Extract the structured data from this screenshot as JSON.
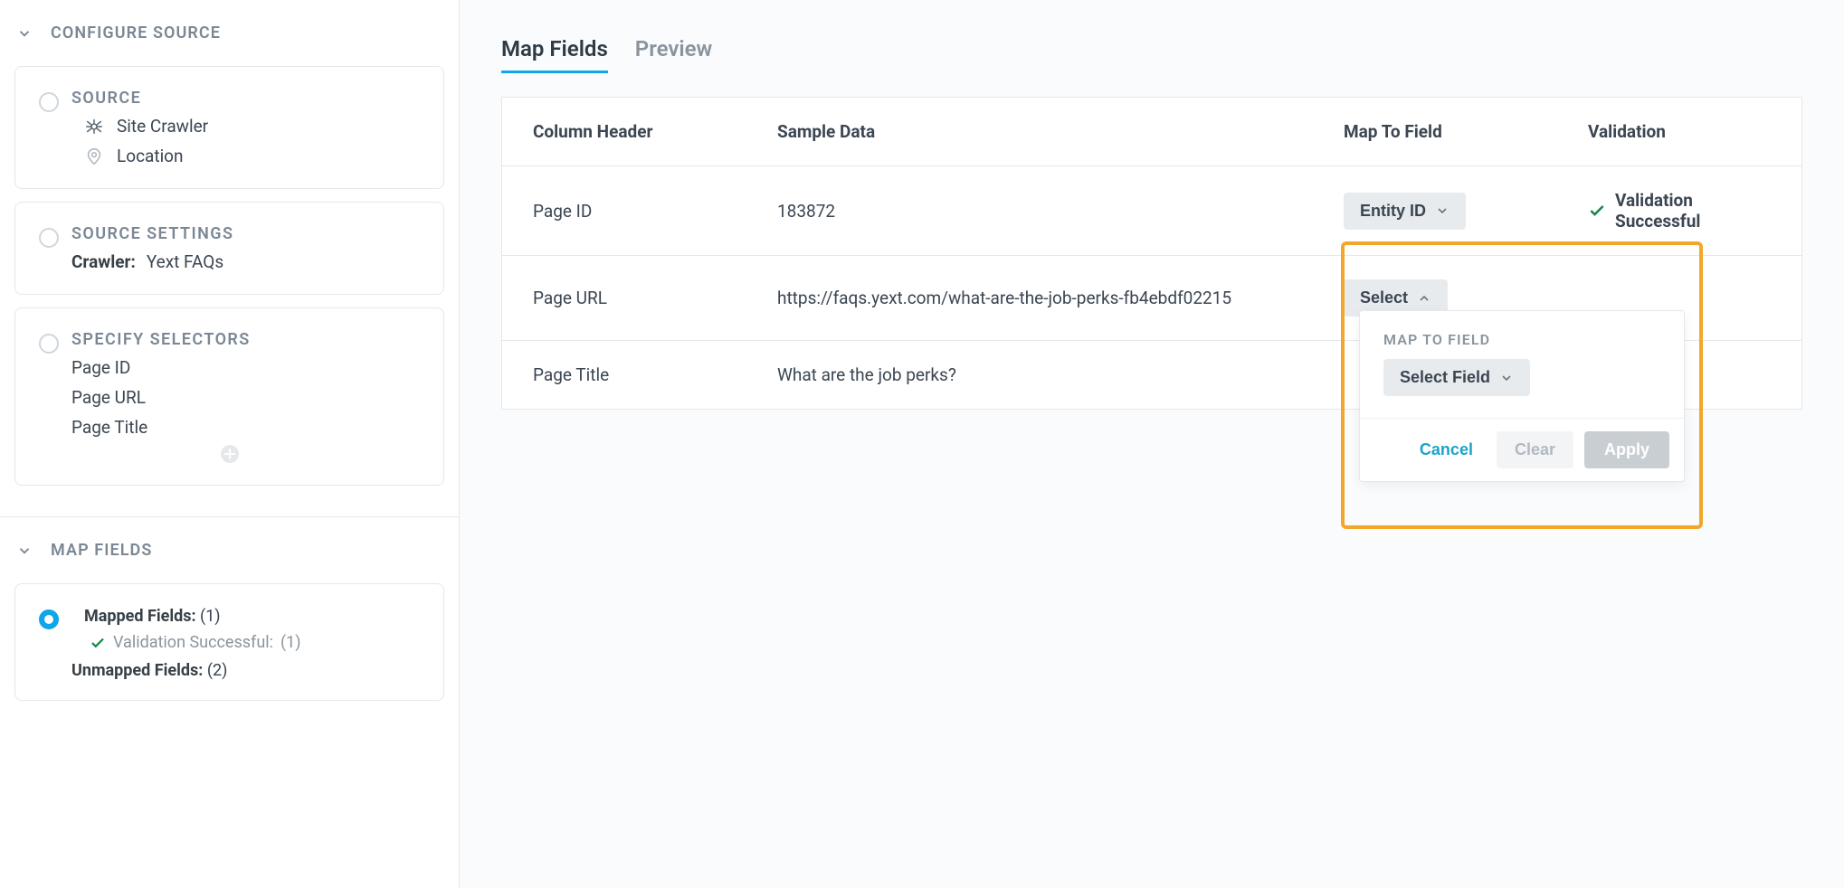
{
  "sidebar": {
    "sections": {
      "configure": {
        "title": "CONFIGURE SOURCE",
        "source": {
          "title": "SOURCE",
          "crawler_label": "Site Crawler",
          "location_label": "Location"
        },
        "source_settings": {
          "title": "SOURCE SETTINGS",
          "field_label": "Crawler:",
          "field_value": "Yext FAQs"
        },
        "specify_selectors": {
          "title": "SPECIFY SELECTORS",
          "items": [
            "Page ID",
            "Page URL",
            "Page Title"
          ]
        }
      },
      "map_fields": {
        "title": "MAP FIELDS",
        "mapped": {
          "label": "Mapped Fields:",
          "count": "(1)"
        },
        "validation": {
          "label": "Validation Successful:",
          "count": "(1)"
        },
        "unmapped": {
          "label": "Unmapped Fields:",
          "count": "(2)"
        }
      }
    }
  },
  "main": {
    "tabs": {
      "map_fields": "Map Fields",
      "preview": "Preview"
    },
    "columns": {
      "column_header": "Column Header",
      "sample_data": "Sample Data",
      "map_to_field": "Map To Field",
      "validation": "Validation"
    },
    "rows": [
      {
        "header": "Page ID",
        "sample": "183872",
        "map_label": "Entity ID",
        "validation": "Validation Successful"
      },
      {
        "header": "Page URL",
        "sample": "https://faqs.yext.com/what-are-the-job-perks-fb4ebdf02215",
        "map_label": "Select"
      },
      {
        "header": "Page Title",
        "sample": "What are the job perks?"
      }
    ],
    "popover": {
      "title": "MAP TO FIELD",
      "select_label": "Select Field",
      "cancel": "Cancel",
      "clear": "Clear",
      "apply": "Apply"
    }
  }
}
